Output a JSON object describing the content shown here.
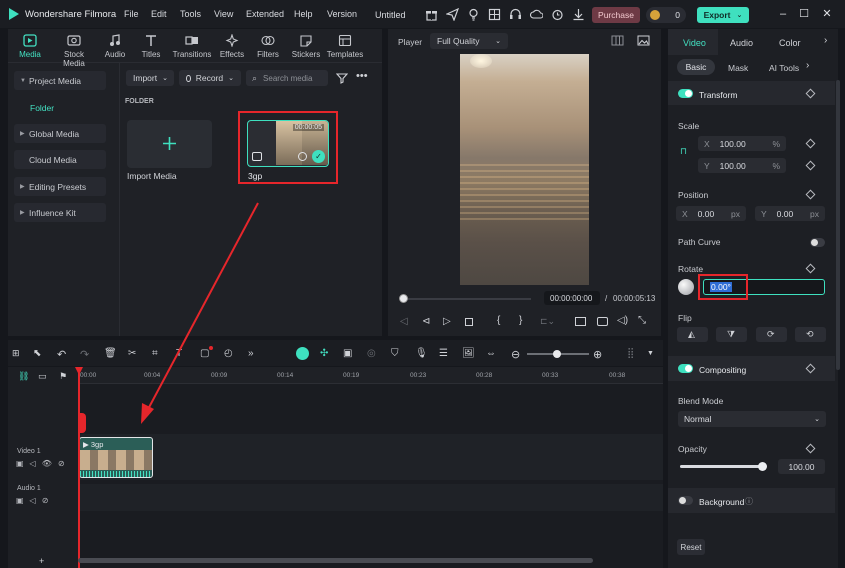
{
  "app": {
    "name": "Wondershare Filmora",
    "project": "Untitled"
  },
  "menu": [
    "File",
    "Edit",
    "Tools",
    "View",
    "Extended",
    "Help",
    "Version"
  ],
  "titlebar": {
    "purchase": "Purchase",
    "coins": "0",
    "export": "Export"
  },
  "media_tabs": [
    {
      "label": "Media",
      "icon": "media-icon"
    },
    {
      "label": "Stock Media",
      "icon": "stock-media-icon"
    },
    {
      "label": "Audio",
      "icon": "music-note-icon"
    },
    {
      "label": "Titles",
      "icon": "title-t-icon"
    },
    {
      "label": "Transitions",
      "icon": "transitions-icon"
    },
    {
      "label": "Effects",
      "icon": "effects-sparkle-icon"
    },
    {
      "label": "Filters",
      "icon": "filters-icon"
    },
    {
      "label": "Stickers",
      "icon": "stickers-icon"
    },
    {
      "label": "Templates",
      "icon": "templates-icon"
    }
  ],
  "sidebar": {
    "items": [
      {
        "label": "Project Media",
        "expanded": true
      },
      {
        "label": "Folder"
      },
      {
        "label": "Global Media"
      },
      {
        "label": "Cloud Media"
      },
      {
        "label": "Editing Presets"
      },
      {
        "label": "Influence Kit"
      }
    ]
  },
  "library": {
    "import_label": "Import",
    "record_label": "Record",
    "search_placeholder": "Search media",
    "folder_heading": "FOLDER",
    "import_media_label": "Import Media",
    "clip_name": "3gp",
    "clip_duration": "00:00:05"
  },
  "player": {
    "label": "Player",
    "quality": "Full Quality",
    "current_time": "00:00:00:00",
    "separator": "/",
    "total_time": "00:00:05:13",
    "progress": 0.0
  },
  "properties": {
    "tabs": [
      "Video",
      "Audio",
      "Color"
    ],
    "subtabs": [
      "Basic",
      "Mask",
      "AI Tools"
    ],
    "transform_label": "Transform",
    "scale_label": "Scale",
    "scale_x_axis": "X",
    "scale_x": "100.00",
    "scale_x_unit": "%",
    "scale_y_axis": "Y",
    "scale_y": "100.00",
    "scale_y_unit": "%",
    "position_label": "Position",
    "pos_x_axis": "X",
    "pos_x": "0.00",
    "pos_x_unit": "px",
    "pos_y_axis": "Y",
    "pos_y": "0.00",
    "pos_y_unit": "px",
    "path_curve_label": "Path Curve",
    "rotate_label": "Rotate",
    "rotate_value": "0.00°",
    "flip_label": "Flip",
    "compositing_label": "Compositing",
    "blend_mode_label": "Blend Mode",
    "blend_mode_value": "Normal",
    "opacity_label": "Opacity",
    "opacity_value": "100.00",
    "opacity_level": 1.0,
    "background_label": "Background",
    "reset_label": "Reset"
  },
  "timeline": {
    "ruler": [
      "00:00",
      "00:04",
      "00:09",
      "00:14",
      "00:19",
      "00:23",
      "00:28",
      "00:33",
      "00:38"
    ],
    "tracks": [
      {
        "label": "Video 1"
      },
      {
        "label": "Audio 1"
      }
    ],
    "clip_label": "3gp"
  },
  "colors": {
    "accent": "#3ee0bf",
    "highlight": "#e6262b",
    "purchase": "#6e3a45",
    "panel": "#1f2126"
  }
}
